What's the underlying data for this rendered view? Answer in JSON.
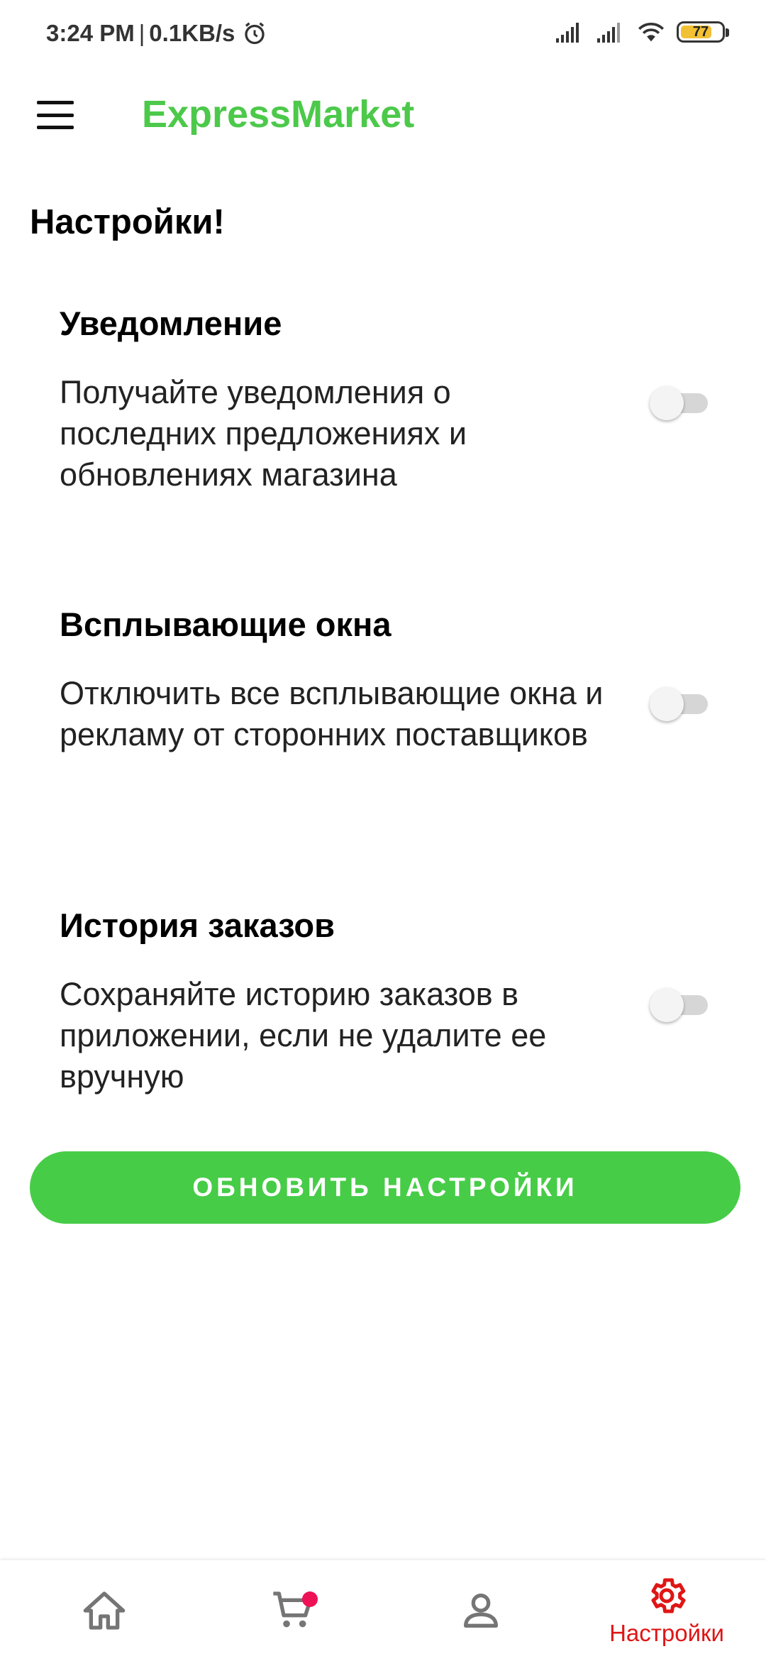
{
  "status_bar": {
    "time": "3:24 PM",
    "separator": "|",
    "network_speed": "0.1KB/s",
    "battery_level": "77",
    "battery_fraction": 0.77,
    "battery_color": "#f2c033"
  },
  "app_bar": {
    "title": "ExpressMarket",
    "title_color": "#4cc94a",
    "menu_icon": "hamburger-menu-icon"
  },
  "page": {
    "title": "Настройки!"
  },
  "settings": [
    {
      "title": "Уведомление",
      "description": "Получайте уведомления о последних предложениях и обновлениях магазина",
      "enabled": false
    },
    {
      "title": "Всплывающие окна",
      "description": "Отключить все всплывающие окна и рекламу от сторонних поставщиков",
      "enabled": false
    },
    {
      "title": "История заказов",
      "description": "Сохраняйте историю заказов в приложении, если не удалите ее вручную",
      "enabled": false
    }
  ],
  "update_button": {
    "label": "ОБНОВИТЬ НАСТРОЙКИ",
    "color": "#47cc47"
  },
  "bottom_nav": {
    "items": [
      {
        "icon": "home-icon",
        "label": "",
        "active": false
      },
      {
        "icon": "cart-icon",
        "label": "",
        "active": false,
        "badge": true
      },
      {
        "icon": "profile-icon",
        "label": "",
        "active": false
      },
      {
        "icon": "gear-icon",
        "label": "Настройки",
        "active": true
      }
    ],
    "active_color": "#e01515",
    "inactive_color": "#757575",
    "badge_color": "#ee1155"
  }
}
